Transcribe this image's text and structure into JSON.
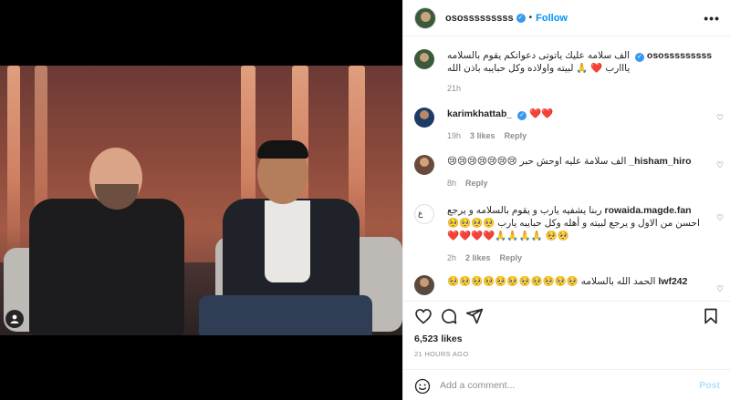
{
  "post": {
    "username": "ososssssssss",
    "follow_label": "Follow",
    "more_label": "•••",
    "likes": "6,523 likes",
    "timestamp": "21 HOURS AGO",
    "add_comment_placeholder": "Add a comment...",
    "post_label": "Post"
  },
  "caption": {
    "username": "ososssssssss",
    "text": "الف سلامه عليك ياتوتى دعواتكم يقوم بالسلامه يااارب ❤️ 🙏 لبيته واولاده وكل حبايبه باذن الله",
    "time": "21h"
  },
  "comments": [
    {
      "username": "karimkhattab_",
      "verified": true,
      "text": "❤️❤️",
      "time": "19h",
      "likes": "3 likes",
      "reply": "Reply"
    },
    {
      "username": "_hisham_hiro",
      "verified": false,
      "text": "الف سلامة عليه اوحش حبر 😢😢😢😢😢😢😢",
      "time": "8h",
      "likes": "",
      "reply": "Reply"
    },
    {
      "username": "rowaida.magde.fan",
      "verified": false,
      "text": "ربنا يشفيه يارب و يقوم بالسلامه و يرجع احسن من الاول و يرجع لبيته و أهله وكل حبايبه يارب 🥺🥺🥺🥺🥺🥺 🙏🙏🙏🙏❤️❤️❤️❤️",
      "time": "2h",
      "likes": "2 likes",
      "reply": "Reply"
    },
    {
      "username": "lwf242",
      "verified": false,
      "text": "الحمد الله بالسلامه 🥺🥺🥺🥺🥺🥺🥺🥺🥺🥺🥺",
      "time": "",
      "likes": "",
      "reply": ""
    }
  ],
  "icons": {
    "like": "heart-outline-icon",
    "comment": "comment-bubble-icon",
    "share": "paper-plane-icon",
    "save": "bookmark-icon",
    "emoji": "smiley-icon",
    "tag": "user-tag-icon"
  },
  "colors": {
    "accent": "#0095f6",
    "verified": "#3897f0",
    "muted": "#8e8e8e",
    "post_disabled": "#b2dffc",
    "heart_red": "#ed4956"
  }
}
